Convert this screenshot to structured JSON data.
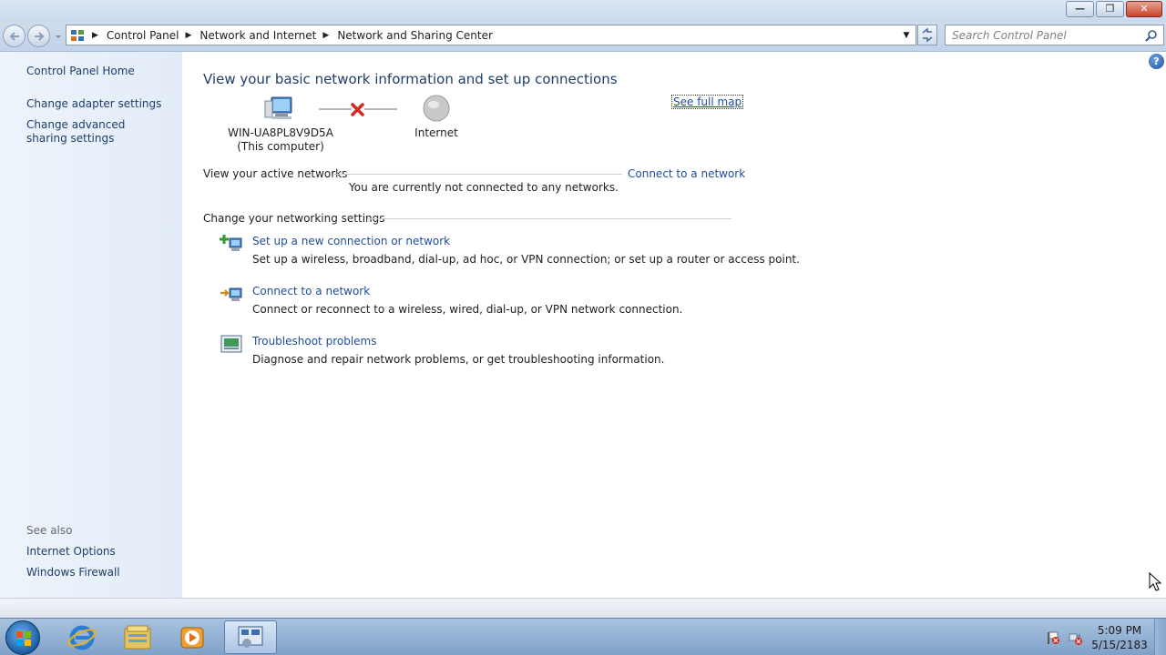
{
  "window": {
    "minimize_glyph": "—",
    "maximize_glyph": "❐",
    "close_glyph": "✕"
  },
  "address_bar": {
    "crumbs": [
      "Control Panel",
      "Network and Internet",
      "Network and Sharing Center"
    ]
  },
  "search": {
    "placeholder": "Search Control Panel"
  },
  "left_pane": {
    "home": "Control Panel Home",
    "links": [
      "Change adapter settings",
      "Change advanced sharing settings"
    ],
    "see_also_heading": "See also",
    "see_also": [
      "Internet Options",
      "Windows Firewall"
    ]
  },
  "main": {
    "help_glyph": "?",
    "title": "View your basic network information and set up connections",
    "see_full_map": "See full map",
    "computer_name": "WIN-UA8PL8V9D5A",
    "computer_sub": "(This computer)",
    "internet_label": "Internet",
    "active_networks_heading": "View your active networks",
    "connect_link": "Connect to a network",
    "not_connected": "You are currently not connected to any networks.",
    "settings_heading": "Change your networking settings",
    "tasks": [
      {
        "link": "Set up a new connection or network",
        "desc": "Set up a wireless, broadband, dial-up, ad hoc, or VPN connection; or set up a router or access point."
      },
      {
        "link": "Connect to a network",
        "desc": "Connect or reconnect to a wireless, wired, dial-up, or VPN network connection."
      },
      {
        "link": "Troubleshoot problems",
        "desc": "Diagnose and repair network problems, or get troubleshooting information."
      }
    ]
  },
  "taskbar": {
    "apps": [
      "start-button",
      "internet-explorer-icon",
      "windows-explorer-icon",
      "media-player-icon",
      "control-panel-icon"
    ],
    "clock_time": "5:09 PM",
    "clock_date": "5/15/2183"
  },
  "colors": {
    "link": "#1e4e9a",
    "title": "#1e3d6b",
    "left_pane_bg": "#e8f0fa",
    "error_red": "#d42a1e"
  }
}
